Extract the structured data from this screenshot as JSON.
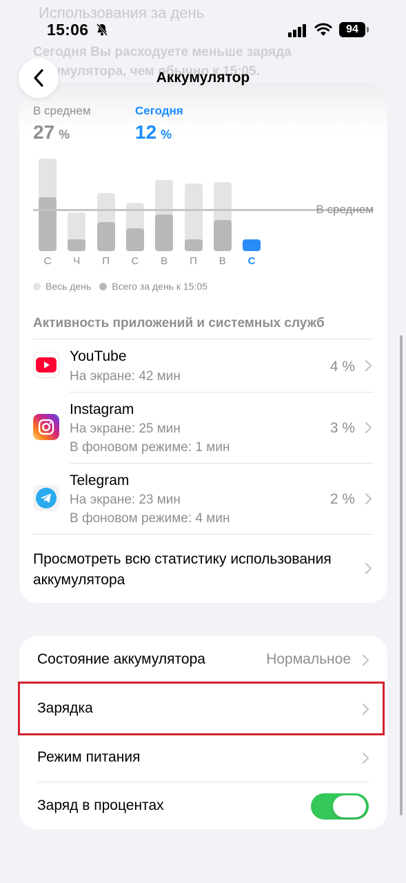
{
  "background": {
    "faded_title": "Использования за день",
    "faded_text": "Сегодня Вы расходуете меньше заряда аккумулятора, чем обычно к 15:05."
  },
  "status_bar": {
    "time": "15:06",
    "battery": "94",
    "icons": [
      "bell-slash-icon",
      "cellular-signal-icon",
      "wifi-icon",
      "battery-icon"
    ]
  },
  "header": {
    "back_icon": "chevron-left-icon",
    "title": "Аккумулятор"
  },
  "summary": {
    "average_label": "В среднем",
    "average_value": "27",
    "average_unit": "%",
    "today_label": "Сегодня",
    "today_value": "12",
    "today_unit": "%"
  },
  "chart_data": {
    "type": "bar",
    "categories": [
      "С",
      "Ч",
      "П",
      "С",
      "В",
      "П",
      "В",
      "С"
    ],
    "series": [
      {
        "name": "Весь день",
        "values": [
          48,
          20,
          30,
          25,
          37,
          35,
          36,
          null
        ]
      },
      {
        "name": "Всего за день к 15:05",
        "values": [
          28,
          6,
          15,
          12,
          19,
          6,
          16,
          6
        ]
      }
    ],
    "average_line_label": "В среднем",
    "average_value": 15,
    "ylim": [
      0,
      48
    ],
    "highlight_category_index": 7,
    "colors": {
      "full_day": "#e4e4e6",
      "to_time": "#b8b8bb",
      "today": "#2a8cf7"
    }
  },
  "legend": [
    {
      "label": "Весь день",
      "color": "#e4e4e6"
    },
    {
      "label": "Всего за день к 15:05",
      "color": "#b8b8bb"
    }
  ],
  "activity": {
    "title": "Активность приложений и системных служб",
    "apps": [
      {
        "name": "YouTube",
        "line1": "На экране: 42 мин",
        "line2": "",
        "percent": "4 %",
        "icon": "youtube-icon"
      },
      {
        "name": "Instagram",
        "line1": "На экране: 25 мин",
        "line2": "В фоновом режиме: 1 мин",
        "percent": "3 %",
        "icon": "instagram-icon"
      },
      {
        "name": "Telegram",
        "line1": "На экране: 23 мин",
        "line2": "В фоновом режиме: 4 мин",
        "percent": "2 %",
        "icon": "telegram-icon"
      }
    ],
    "view_all": "Просмотреть всю статистику использования аккумулятора"
  },
  "settings": {
    "health_label": "Состояние аккумулятора",
    "health_value": "Нормальное",
    "charging_label": "Зарядка",
    "power_mode_label": "Режим питания",
    "percentage_label": "Заряд в процентах",
    "percentage_on": true
  },
  "colors": {
    "accent": "#1a8cff",
    "toggle_on": "#34c759",
    "highlight_frame": "#d32030"
  }
}
